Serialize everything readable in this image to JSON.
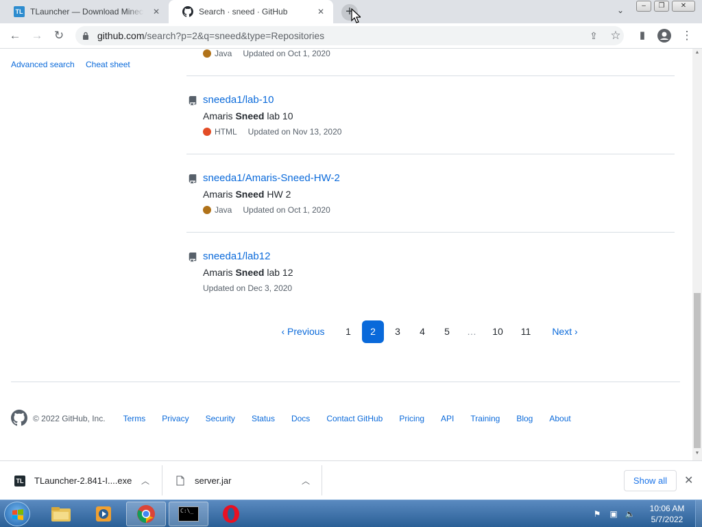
{
  "browser": {
    "tabs": [
      {
        "title": "TLauncher — Download Minecraft",
        "favicon": "tlauncher-logo",
        "badge": "TL"
      },
      {
        "title": "Search · sneed · GitHub",
        "favicon": "github-icon"
      }
    ],
    "address": {
      "host": "github.com",
      "path": "/search?p=2&q=sneed&type=Repositories"
    }
  },
  "sidebar": {
    "advanced_search": "Advanced search",
    "cheat_sheet": "Cheat sheet"
  },
  "results": {
    "partial": {
      "language": "Java",
      "language_color": "#b07219",
      "updated": "Updated on Oct 1, 2020"
    },
    "repos": [
      {
        "name": "sneeda1/lab-10",
        "desc_pre": "Amaris ",
        "desc_match": "Sneed",
        "desc_post": " lab 10",
        "language": "HTML",
        "language_color": "#e34c26",
        "updated": "Updated on Nov 13, 2020"
      },
      {
        "name": "sneeda1/Amaris-Sneed-HW-2",
        "desc_pre": "Amaris ",
        "desc_match": "Sneed",
        "desc_post": " HW 2",
        "language": "Java",
        "language_color": "#b07219",
        "updated": "Updated on Oct 1, 2020"
      },
      {
        "name": "sneeda1/lab12",
        "desc_pre": "Amaris ",
        "desc_match": "Sneed",
        "desc_post": " lab 12",
        "language": "",
        "updated": "Updated on Dec 3, 2020"
      }
    ]
  },
  "pagination": {
    "previous": "Previous",
    "next": "Next",
    "pages": [
      "1",
      "2",
      "3",
      "4",
      "5",
      "…",
      "10",
      "11"
    ],
    "current": "2"
  },
  "footer": {
    "copyright": "© 2022 GitHub, Inc.",
    "links": [
      "Terms",
      "Privacy",
      "Security",
      "Status",
      "Docs",
      "Contact GitHub",
      "Pricing",
      "API",
      "Training",
      "Blog",
      "About"
    ]
  },
  "downloads": {
    "items": [
      {
        "name": "TLauncher-2.841-I....exe",
        "icon": "tlauncher-logo",
        "badge": "TL"
      },
      {
        "name": "server.jar",
        "icon": "file-icon"
      }
    ],
    "show_all": "Show all"
  },
  "taskbar": {
    "apps": [
      "explorer-icon",
      "media-player-icon",
      "chrome-icon",
      "cmd-icon",
      "opera-icon"
    ],
    "cmd_label": "C:\\_",
    "time": "10:06 AM",
    "date": "5/7/2022"
  },
  "colors": {
    "link": "#0969da",
    "accent": "#0969da",
    "taskbar": "#2a5f96"
  }
}
